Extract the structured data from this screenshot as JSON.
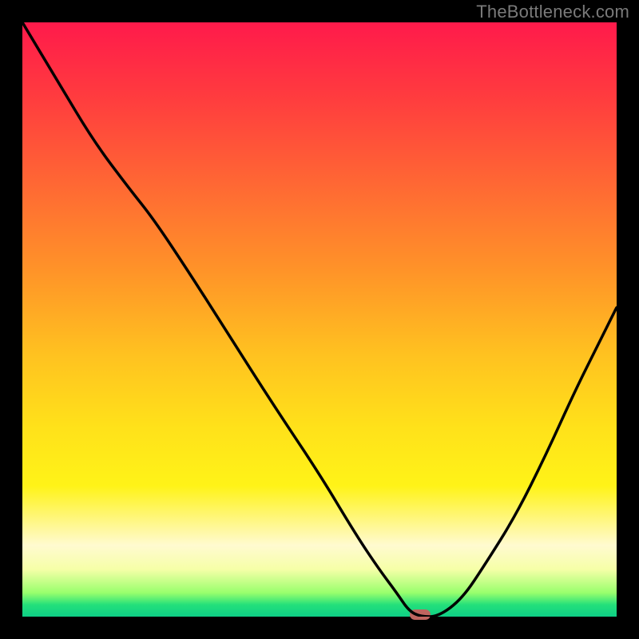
{
  "watermark": "TheBottleneck.com",
  "chart_data": {
    "type": "line",
    "title": "",
    "xlabel": "",
    "ylabel": "",
    "xlim": [
      0,
      100
    ],
    "ylim": [
      0,
      100
    ],
    "x": [
      0,
      6,
      12,
      18,
      22,
      28,
      35,
      42,
      50,
      56,
      60,
      63,
      65,
      67,
      70,
      74,
      78,
      83,
      88,
      93,
      97,
      100
    ],
    "values": [
      100,
      90,
      80,
      72,
      67,
      58,
      47,
      36,
      24,
      14,
      8,
      4,
      1,
      0,
      0,
      3,
      9,
      17,
      27,
      38,
      46,
      52
    ],
    "marker": {
      "x": 67,
      "y": 0
    },
    "gradient_stops": [
      {
        "pos": 0,
        "color": "#ff1a4b"
      },
      {
        "pos": 12,
        "color": "#ff3a3f"
      },
      {
        "pos": 28,
        "color": "#ff6a33"
      },
      {
        "pos": 42,
        "color": "#ff9428"
      },
      {
        "pos": 56,
        "color": "#ffc220"
      },
      {
        "pos": 68,
        "color": "#ffe11a"
      },
      {
        "pos": 78,
        "color": "#fff318"
      },
      {
        "pos": 88,
        "color": "#fffad0"
      },
      {
        "pos": 92,
        "color": "#f6ffa8"
      },
      {
        "pos": 96,
        "color": "#98ff6d"
      },
      {
        "pos": 98,
        "color": "#24e07a"
      },
      {
        "pos": 100,
        "color": "#0ecf86"
      }
    ]
  }
}
